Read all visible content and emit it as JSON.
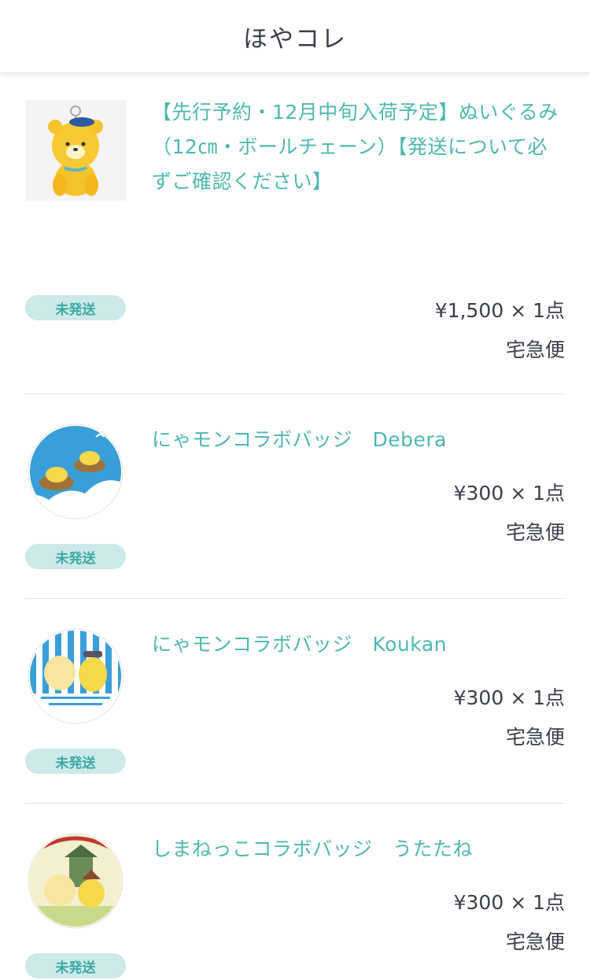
{
  "header": {
    "title": "ほやコレ"
  },
  "items": [
    {
      "name": "【先行予約・12月中旬入荷予定】ぬいぐるみ（12㎝・ボールチェーン）【発送について必ずご確認ください】",
      "status": "未発送",
      "price": "¥1,500 × 1点",
      "shipping": "宅急便",
      "image_icon": "yellow-bear-plush-icon"
    },
    {
      "name": "にゃモンコラボバッジ　Debera",
      "status": "未発送",
      "price": "¥300 × 1点",
      "shipping": "宅急便",
      "image_icon": "badge-debera-icon"
    },
    {
      "name": "にゃモンコラボバッジ　Koukan",
      "status": "未発送",
      "price": "¥300 × 1点",
      "shipping": "宅急便",
      "image_icon": "badge-koukan-icon"
    },
    {
      "name": "しまねっこコラボバッジ　うたたね",
      "status": "未発送",
      "price": "¥300 × 1点",
      "shipping": "宅急便",
      "image_icon": "badge-utatane-icon"
    }
  ],
  "colors": {
    "accent": "#4fb8b1",
    "badge_bg": "#cde9e9",
    "badge_text": "#3ba9a4",
    "text": "#3a3f4a"
  }
}
